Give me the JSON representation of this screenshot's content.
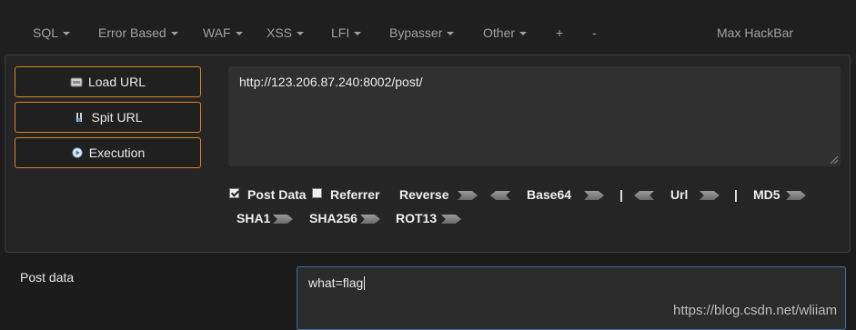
{
  "menu": {
    "items": [
      {
        "label": "SQL",
        "caret": true
      },
      {
        "label": "Error Based",
        "caret": true
      },
      {
        "label": "WAF",
        "caret": true
      },
      {
        "label": "XSS",
        "caret": true
      },
      {
        "label": "LFI",
        "caret": true
      },
      {
        "label": "Bypasser",
        "caret": true
      },
      {
        "label": "Other",
        "caret": true
      },
      {
        "label": "+",
        "caret": false
      },
      {
        "label": "-",
        "caret": false
      }
    ],
    "brand": "Max HackBar"
  },
  "buttons": {
    "load": "Load URL",
    "split": "Spit URL",
    "execute": "Execution"
  },
  "url": {
    "value": "http://123.206.87.240:8002/post/"
  },
  "options": {
    "post_data": {
      "label": "Post Data",
      "checked": true
    },
    "referrer": {
      "label": "Referrer",
      "checked": false
    },
    "reverse": "Reverse",
    "base64": "Base64",
    "separator": "|",
    "url": "Url",
    "md5": "MD5",
    "sha1": "SHA1",
    "sha256": "SHA256",
    "rot13": "ROT13"
  },
  "post": {
    "label": "Post data",
    "value": "what=flag"
  },
  "watermark": "https://blog.csdn.net/wliiam"
}
